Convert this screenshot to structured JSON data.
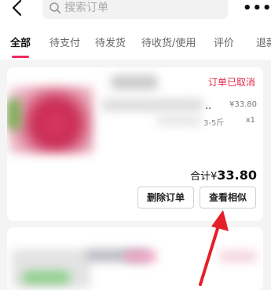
{
  "header": {
    "search_placeholder": "搜索订单",
    "more_label": "•••"
  },
  "tabs": [
    {
      "label": "全部"
    },
    {
      "label": "待支付"
    },
    {
      "label": "待发货"
    },
    {
      "label": "待收货/使用"
    },
    {
      "label": "评价"
    },
    {
      "label": "退款"
    }
  ],
  "order": {
    "status": "订单已取消",
    "title_tail": "..",
    "unit_price": "¥33.80",
    "spec": "3-5斤",
    "quantity": "x1",
    "total_label": "合计¥",
    "total_amount": "33.80",
    "delete_button": "删除订单",
    "similar_button": "查看相似"
  },
  "colors": {
    "accent": "#ee2a5b",
    "status_red": "#e8264a",
    "arrow_red": "#e5202b"
  }
}
